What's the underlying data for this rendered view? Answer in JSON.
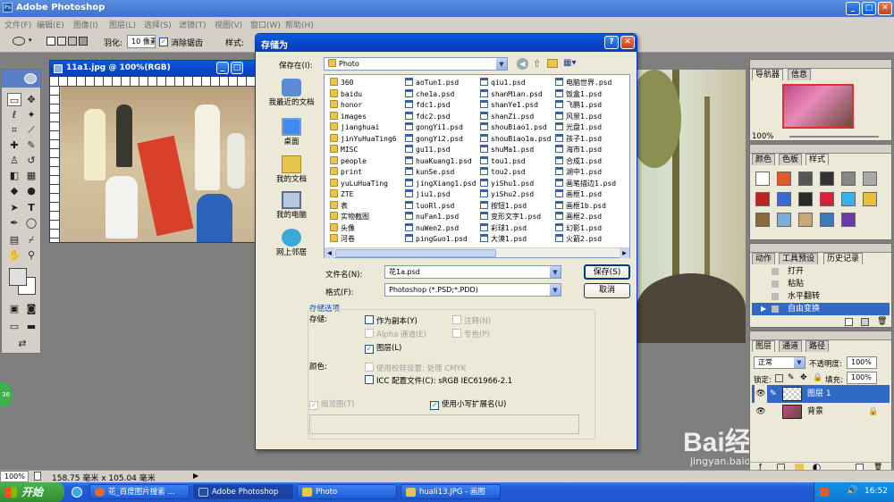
{
  "app": {
    "title": "Adobe Photoshop",
    "menu": [
      "文件(F)",
      "编辑(E)",
      "图像(I)",
      "图层(L)",
      "选择(S)",
      "滤镜(T)",
      "视图(V)",
      "窗口(W)",
      "帮助(H)"
    ]
  },
  "options": {
    "feather_label": "羽化:",
    "feather_value": "10 像素",
    "antialias_label": "消除锯齿",
    "style_label": "样式:"
  },
  "doc": {
    "title": "11a1.jpg @ 100%(RGB)"
  },
  "dialog": {
    "title": "存储为",
    "save_in_label": "保存在(I):",
    "save_in_value": "Photo",
    "nav": [
      "我最近的文档",
      "桌面",
      "我的文档",
      "我的电脑",
      "网上邻居"
    ],
    "columns": [
      [
        "360",
        "baidu",
        "honor",
        "images",
        "jianghuai",
        "jinYuHuaTing6",
        "MISC",
        "people",
        "print",
        "yuLuHuaTing",
        "ZTE",
        "表",
        "实物截图",
        "头像",
        "河卷"
      ],
      [
        "aoTun1.psd",
        "che1a.psd",
        "fdc1.psd",
        "fdc2.psd",
        "gongYi1.psd",
        "gongYi2.psd",
        "gu11.psd",
        "huaKuang1.psd",
        "kunSe.psd",
        "jingXiang1.psd",
        "jiu1.psd",
        "luoRl.psd",
        "nuFan1.psd",
        "nuWen2.psd",
        "pingGuo1.psd"
      ],
      [
        "qiu1.psd",
        "shanMian.psd",
        "shanYe1.psd",
        "shanZi.psd",
        "shouBiao1.psd",
        "shouBiao1a.psd",
        "shuMa1.psd",
        "tou1.psd",
        "tou2.psd",
        "yiShu1.psd",
        "yiShu2.psd",
        "按钮1.psd",
        "变形文字1.psd",
        "彩球1.psd",
        "大漠1.psd"
      ],
      [
        "电脑世界.psd",
        "饭盒1.psd",
        "飞鹏1.psd",
        "风景1.psd",
        "光盘1.psd",
        "孩子1.psd",
        "海市1.psd",
        "合成1.psd",
        "湖中1.psd",
        "画笔描边1.psd",
        "画框1.psd",
        "画框1b.psd",
        "画框2.psd",
        "幻影1.psd",
        "火箭2.psd"
      ]
    ],
    "filename_label": "文件名(N):",
    "filename_value": "花1a.psd",
    "format_label": "格式(F):",
    "format_value": "Photoshop (*.PSD;*.PDD)",
    "save_button": "保存(S)",
    "cancel_button": "取消",
    "options_title": "存储选项",
    "storage_label": "存储:",
    "as_copy": "作为副本(Y)",
    "alpha": "Alpha 通道(E)",
    "layers": "图层(L)",
    "notes": "注释(N)",
    "spot": "专色(P)",
    "color_label": "颜色:",
    "use_proof": "使用校样设置: 处理 CMYK",
    "icc": "ICC 配置文件(C): sRGB IEC61966-2.1",
    "thumbnail": "缩览图(T)",
    "lowercase_ext": "使用小写扩展名(U)"
  },
  "panels": {
    "navigator_tabs": [
      "导航器",
      "信息"
    ],
    "navigator_zoom": "100%",
    "color_tabs": [
      "颜色",
      "色板",
      "样式"
    ],
    "history_tabs": [
      "动作",
      "工具预设",
      "历史记录"
    ],
    "history_items": [
      "打开",
      "粘贴",
      "水平翻转",
      "自由变换"
    ],
    "layers_tabs": [
      "图层",
      "通道",
      "路径"
    ],
    "blend_mode": "正常",
    "opacity_label": "不透明度:",
    "opacity_value": "100%",
    "lock_label": "锁定:",
    "fill_label": "填充:",
    "fill_value": "100%",
    "layers": [
      "图层 1",
      "背景"
    ]
  },
  "status": {
    "zoom": "100%",
    "size": "158.75 毫米 x 105.04 毫米"
  },
  "taskbar": {
    "start": "开始",
    "items": [
      "花_百度图片搜索 ...",
      "Adobe Photoshop",
      "Photo",
      "huali13.JPG - 画图"
    ],
    "clock": "16:52"
  },
  "watermark": {
    "brand": "Bai经验",
    "url": "jingyan.baidu.com"
  },
  "colors": {
    "xp_blue": "#0a5ae0",
    "dialog_bg": "#ece9d8",
    "selection": "#316ac5",
    "taskbar": "#245edb"
  }
}
